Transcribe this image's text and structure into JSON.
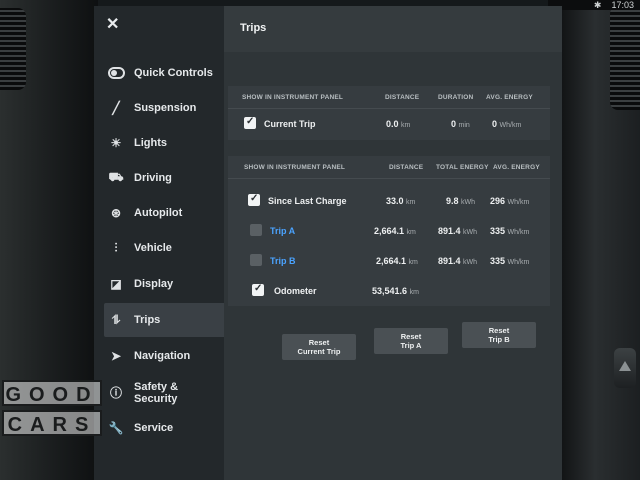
{
  "status": {
    "time": "17:03",
    "bluetooth_icon": "bluetooth-icon"
  },
  "sidebar": {
    "close_icon": "close-icon",
    "items": [
      {
        "label": "Quick Controls",
        "icon": "toggle-icon"
      },
      {
        "label": "Suspension",
        "icon": "suspension-icon"
      },
      {
        "label": "Lights",
        "icon": "light-icon"
      },
      {
        "label": "Driving",
        "icon": "car-icon"
      },
      {
        "label": "Autopilot",
        "icon": "steering-wheel-icon"
      },
      {
        "label": "Vehicle",
        "icon": "sliders-icon"
      },
      {
        "label": "Display",
        "icon": "display-icon"
      },
      {
        "label": "Trips",
        "icon": "trips-icon",
        "active": true
      },
      {
        "label": "Navigation",
        "icon": "navigation-arrow-icon"
      },
      {
        "label": "Safety &\nSecurity",
        "icon": "info-circle-icon"
      },
      {
        "label": "Service",
        "icon": "wrench-icon"
      }
    ]
  },
  "content": {
    "title": "Trips",
    "panel1": {
      "headers": {
        "show": "SHOW IN INSTRUMENT PANEL",
        "distance": "DISTANCE",
        "duration": "DURATION",
        "avg_energy": "AVG. ENERGY"
      },
      "row": {
        "label": "Current Trip",
        "checked": true,
        "distance": "0.0",
        "distance_unit": "km",
        "duration": "0",
        "duration_unit": "min",
        "energy": "0",
        "energy_unit": "Wh/km"
      }
    },
    "panel2": {
      "headers": {
        "show": "SHOW IN INSTRUMENT PANEL",
        "distance": "DISTANCE",
        "total_energy": "TOTAL ENERGY",
        "avg_energy": "AVG. ENERGY"
      },
      "rows": [
        {
          "label": "Since Last Charge",
          "checked": true,
          "link": false,
          "distance": "33.0",
          "distance_unit": "km",
          "total": "9.8",
          "total_unit": "kWh",
          "avg": "296",
          "avg_unit": "Wh/km"
        },
        {
          "label": "Trip A",
          "checked": false,
          "link": true,
          "distance": "2,664.1",
          "distance_unit": "km",
          "total": "891.4",
          "total_unit": "kWh",
          "avg": "335",
          "avg_unit": "Wh/km"
        },
        {
          "label": "Trip B",
          "checked": false,
          "link": true,
          "distance": "2,664.1",
          "distance_unit": "km",
          "total": "891.4",
          "total_unit": "kWh",
          "avg": "335",
          "avg_unit": "Wh/km"
        },
        {
          "label": "Odometer",
          "checked": true,
          "link": false,
          "distance": "53,541.6",
          "distance_unit": "km"
        }
      ]
    },
    "buttons": {
      "reset_current": "Reset\nCurrent Trip",
      "reset_a": "Reset\nTrip A",
      "reset_b": "Reset\nTrip B"
    }
  },
  "watermark": {
    "line1": "GOOD",
    "line2": "CARS"
  },
  "colors": {
    "accent_link": "#4aa3ff",
    "panel_bg": "#363c40",
    "screen_bg": "#22272a"
  }
}
